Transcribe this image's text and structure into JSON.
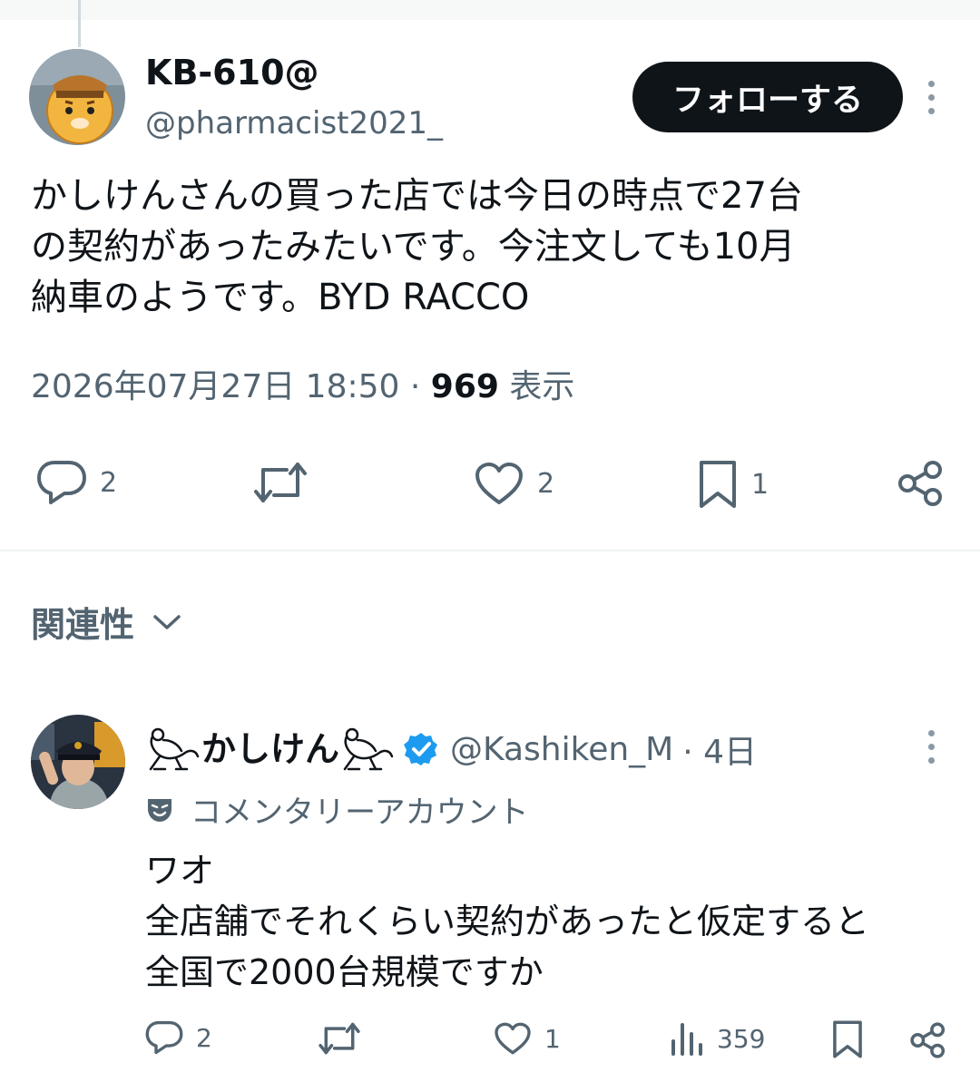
{
  "tweet": {
    "author_name": "KB-610@",
    "author_handle": "@pharmacist2021_",
    "follow_label": "フォローする",
    "text_lines": [
      "かしけんさんの買った店では今日の時点で27台",
      "の契約があったみたいです。今注文しても10月",
      "納車のようです。BYD RACCO"
    ],
    "timestamp": "2026年07月27日 18:50",
    "separator": " · ",
    "views_count": "969",
    "views_label": " 表示",
    "actions": {
      "replies": "2",
      "reposts": "",
      "likes": "2",
      "bookmarks": "1"
    }
  },
  "sort": {
    "label": "関連性"
  },
  "reply": {
    "author_name": "かしけん",
    "author_handle": "@Kashiken_M",
    "time": "· 4日",
    "commentary_label": "コメンタリーアカウント",
    "text_lines": [
      "ワオ",
      "全店舗でそれくらい契約があったと仮定すると",
      "全国で2000台規模ですか"
    ],
    "actions": {
      "replies": "2",
      "reposts": "",
      "likes": "1",
      "views": "359"
    }
  },
  "icons": {
    "reply": "speech-bubble-icon",
    "repost": "repost-arrows-icon",
    "like": "heart-icon",
    "bookmark": "bookmark-icon",
    "share": "share-icon",
    "views": "bar-chart-icon",
    "verified": "verified-badge-icon",
    "commentary": "theater-mask-icon",
    "frog": "frog-emoji-icon",
    "more": "more-vertical-icon",
    "chevron": "chevron-down-icon"
  },
  "colors": {
    "text": "#0f1419",
    "secondary": "#536471",
    "verified": "#1d9bf0",
    "follow_bg": "#0f1419"
  }
}
